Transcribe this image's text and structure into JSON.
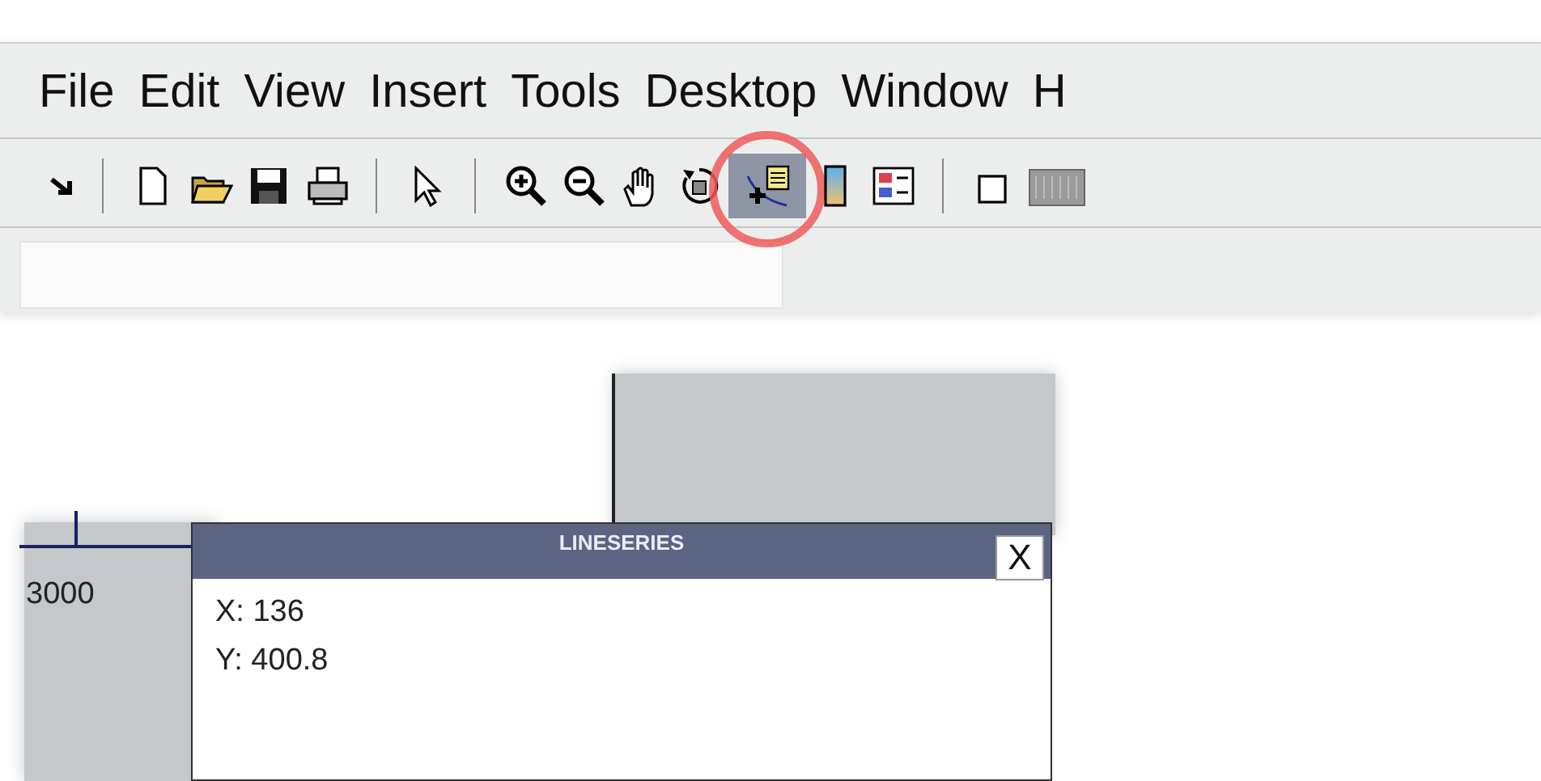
{
  "menu_bar": [
    "File",
    "Edit",
    "View",
    "Insert",
    "Tools",
    "Desktop",
    "Window",
    "H"
  ],
  "toolbar": [
    {
      "kind": "dock-arrow",
      "selected": false,
      "highlighted": false
    },
    {
      "kind": "separator"
    },
    {
      "kind": "new",
      "selected": false,
      "highlighted": false
    },
    {
      "kind": "open",
      "selected": false,
      "highlighted": false
    },
    {
      "kind": "save",
      "selected": false,
      "highlighted": false
    },
    {
      "kind": "print",
      "selected": false,
      "highlighted": false
    },
    {
      "kind": "separator"
    },
    {
      "kind": "pointer",
      "selected": false,
      "highlighted": false
    },
    {
      "kind": "separator"
    },
    {
      "kind": "zoom-in",
      "selected": false,
      "highlighted": false
    },
    {
      "kind": "zoom-out",
      "selected": false,
      "highlighted": false
    },
    {
      "kind": "pan",
      "selected": false,
      "highlighted": false
    },
    {
      "kind": "rotate",
      "selected": false,
      "highlighted": false
    },
    {
      "kind": "data-cursor",
      "selected": true,
      "highlighted": true
    },
    {
      "kind": "colorbar",
      "selected": false,
      "highlighted": false
    },
    {
      "kind": "legend",
      "selected": false,
      "highlighted": false
    },
    {
      "kind": "separator"
    },
    {
      "kind": "square",
      "selected": false,
      "highlighted": false
    },
    {
      "kind": "grid",
      "selected": false,
      "highlighted": false
    }
  ],
  "plot": {
    "tick_label": "3000"
  },
  "data_tip": {
    "title": "LINESERIES",
    "close": "X",
    "lines": [
      "X: 136",
      "Y: 400.8"
    ]
  }
}
